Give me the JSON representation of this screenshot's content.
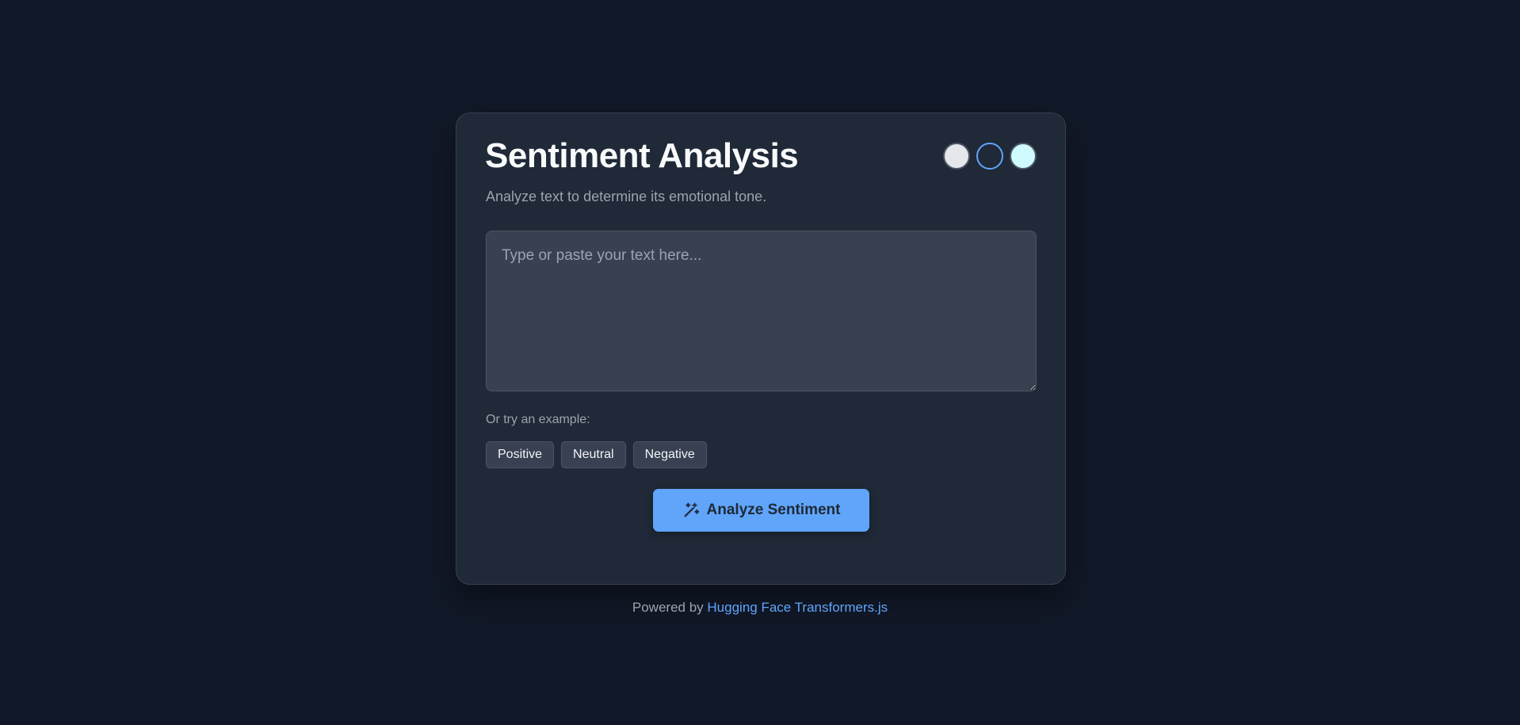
{
  "header": {
    "title": "Sentiment Analysis",
    "subtitle": "Analyze text to determine its emotional tone."
  },
  "theme_switcher": {
    "swatches": [
      {
        "name": "light",
        "color": "#e5e7eb",
        "active": false
      },
      {
        "name": "dark",
        "color": "#1f2937",
        "active": true
      },
      {
        "name": "cyan",
        "color": "#cffafe",
        "active": false
      }
    ]
  },
  "input": {
    "value": "",
    "placeholder": "Type or paste your text here..."
  },
  "examples": {
    "label": "Or try an example:",
    "buttons": [
      "Positive",
      "Neutral",
      "Negative"
    ]
  },
  "action": {
    "label": "Analyze Sentiment",
    "icon": "magic-wand-icon"
  },
  "footer": {
    "prefix": "Powered by",
    "link_text": "Hugging Face Transformers.js"
  },
  "colors": {
    "background": "#111827",
    "card": "#1f2937",
    "accent": "#60a5fa"
  }
}
